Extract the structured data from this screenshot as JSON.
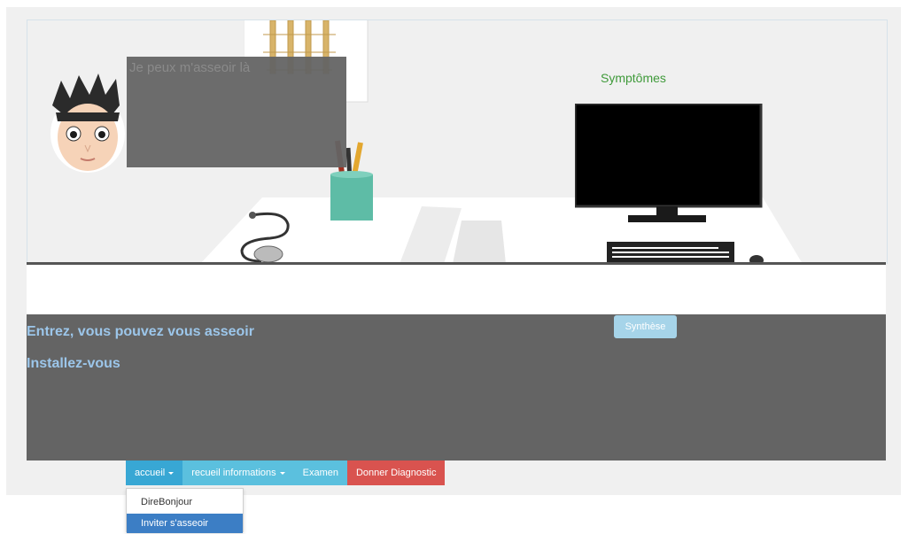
{
  "scene": {
    "bubble_text": "Je peux m'asseoir là",
    "symptoms_label": "Symptômes"
  },
  "dialog": {
    "lines": [
      "Entrez, vous pouvez vous asseoir",
      "Installez-vous"
    ]
  },
  "synthese_label": "Synthèse",
  "navbar": {
    "items": [
      {
        "label": "accueil",
        "color": "#38a7d4"
      },
      {
        "label": "recueil informations",
        "color": "#5bc0de"
      },
      {
        "label": "Examen",
        "color": "#5bc0de"
      },
      {
        "label": "Donner Diagnostic",
        "color": "#d9534f"
      }
    ]
  },
  "dropdown": {
    "items": [
      "DireBonjour",
      "Inviter s'asseoir"
    ],
    "active_item": "Inviter s'asseoir"
  },
  "colors": {
    "panel": "#646464",
    "dialog_text": "#9cc6ea",
    "symptoms": "#3f9a3a"
  }
}
